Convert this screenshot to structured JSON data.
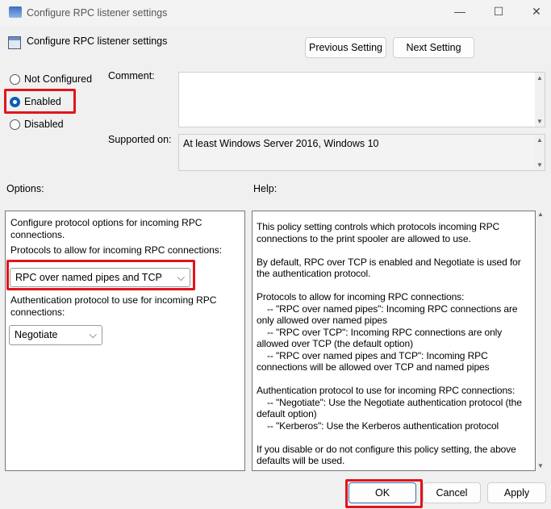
{
  "window": {
    "title": "Configure RPC listener settings",
    "minimize": "—",
    "maximize": "☐",
    "close": "✕"
  },
  "header": {
    "title": "Configure RPC listener settings",
    "previous_label": "Previous Setting",
    "next_label": "Next Setting"
  },
  "state": {
    "options": [
      "Not Configured",
      "Enabled",
      "Disabled"
    ],
    "selected": "Enabled"
  },
  "comment": {
    "label": "Comment:",
    "value": ""
  },
  "supported": {
    "label": "Supported on:",
    "value": "At least Windows Server 2016, Windows 10"
  },
  "options": {
    "label": "Options:",
    "intro": "Configure protocol options for incoming RPC connections.",
    "protocols_label": "Protocols to allow for incoming RPC connections:",
    "protocols_value": "RPC over named pipes and TCP",
    "auth_label": "Authentication protocol to use for incoming RPC connections:",
    "auth_value": "Negotiate"
  },
  "help": {
    "label": "Help:",
    "paragraphs": [
      "This policy setting controls which protocols incoming RPC connections to the print spooler are allowed to use.",
      "By default, RPC over TCP is enabled and Negotiate is used for the authentication protocol.",
      "Protocols to allow for incoming RPC connections:\n    -- \"RPC over named pipes\": Incoming RPC connections are only allowed over named pipes\n    -- \"RPC over TCP\": Incoming RPC connections are only allowed over TCP (the default option)\n    -- \"RPC over named pipes and TCP\": Incoming RPC connections will be allowed over TCP and named pipes",
      "Authentication protocol to use for incoming RPC connections:\n    -- \"Negotiate\": Use the Negotiate authentication protocol (the default option)\n    -- \"Kerberos\": Use the Kerberos authentication protocol",
      "If you disable or do not configure this policy setting, the above defaults will be used."
    ]
  },
  "footer": {
    "ok": "OK",
    "cancel": "Cancel",
    "apply": "Apply"
  }
}
